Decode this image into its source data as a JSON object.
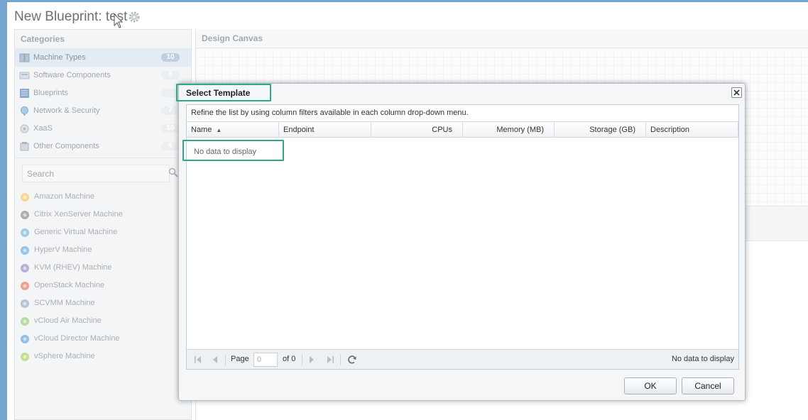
{
  "header": {
    "title": "New Blueprint: test"
  },
  "categories": {
    "title": "Categories",
    "items": [
      {
        "label": "Machine Types",
        "count": "10",
        "icon": "machine-types-icon",
        "selected": true
      },
      {
        "label": "Software Components",
        "count": "0",
        "icon": "software-components-icon"
      },
      {
        "label": "Blueprints",
        "count": "",
        "icon": "blueprints-icon"
      },
      {
        "label": "Network & Security",
        "count": "7",
        "icon": "network-security-icon"
      },
      {
        "label": "XaaS",
        "count": "10",
        "icon": "xaas-icon"
      },
      {
        "label": "Other Components",
        "count": "6",
        "icon": "other-components-icon"
      }
    ],
    "search_placeholder": "Search",
    "machines": [
      {
        "label": "Amazon Machine",
        "icon": "amazon-icon",
        "color": "#f5b73b"
      },
      {
        "label": "Citrix XenServer Machine",
        "icon": "citrix-icon",
        "color": "#6b6f73"
      },
      {
        "label": "Generic Virtual Machine",
        "icon": "generic-vm-icon",
        "color": "#5aa7d6"
      },
      {
        "label": "HyperV Machine",
        "icon": "hyperv-icon",
        "color": "#3d9be0"
      },
      {
        "label": "KVM (RHEV) Machine",
        "icon": "kvm-icon",
        "color": "#8a6fb0"
      },
      {
        "label": "OpenStack Machine",
        "icon": "openstack-icon",
        "color": "#e2553a"
      },
      {
        "label": "SCVMM Machine",
        "icon": "scvmm-icon",
        "color": "#7d98b5"
      },
      {
        "label": "vCloud Air Machine",
        "icon": "vcloud-air-icon",
        "color": "#7fc35a"
      },
      {
        "label": "vCloud Director Machine",
        "icon": "vcloud-director-icon",
        "color": "#3f8fd0"
      },
      {
        "label": "vSphere Machine",
        "icon": "vsphere-icon",
        "color": "#9ac83c"
      }
    ]
  },
  "canvas": {
    "title": "Design Canvas"
  },
  "dialog": {
    "title": "Select Template",
    "hint": "Refine the list by using column filters available in each column drop-down menu.",
    "columns": {
      "name": "Name",
      "endpoint": "Endpoint",
      "cpus": "CPUs",
      "memory": "Memory (MB)",
      "storage": "Storage (GB)",
      "description": "Description"
    },
    "empty": "No data to display",
    "pager": {
      "page_label": "Page",
      "page_value": "0",
      "of_label": "of 0",
      "status": "No data to display"
    },
    "ok_label": "OK",
    "cancel_label": "Cancel"
  },
  "colors": {
    "accent": "#2a74b8",
    "highlight": "#2eaa8a",
    "selected_row": "#d5e1ee"
  }
}
